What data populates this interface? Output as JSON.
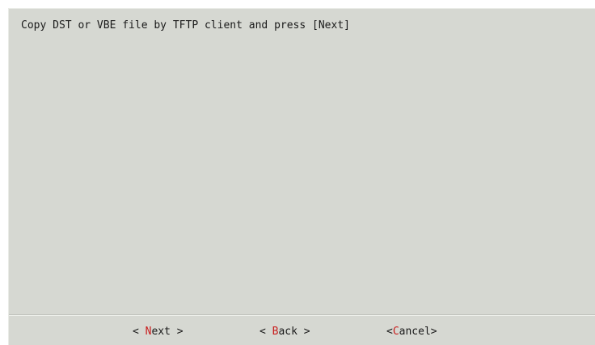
{
  "dialog": {
    "message": "Copy DST or VBE file by TFTP client and press [Next]"
  },
  "buttons": {
    "next": {
      "prefix": "< ",
      "hotkey": "N",
      "rest": "ext",
      "suffix": " >"
    },
    "back": {
      "prefix": "< ",
      "hotkey": "B",
      "rest": "ack",
      "suffix": " >"
    },
    "cancel": {
      "prefix": "<",
      "hotkey": "C",
      "rest": "ancel",
      "suffix": ">"
    }
  },
  "colors": {
    "background": "#d6d8d2",
    "text": "#1a1a1a",
    "hotkey": "#c81d1d"
  }
}
